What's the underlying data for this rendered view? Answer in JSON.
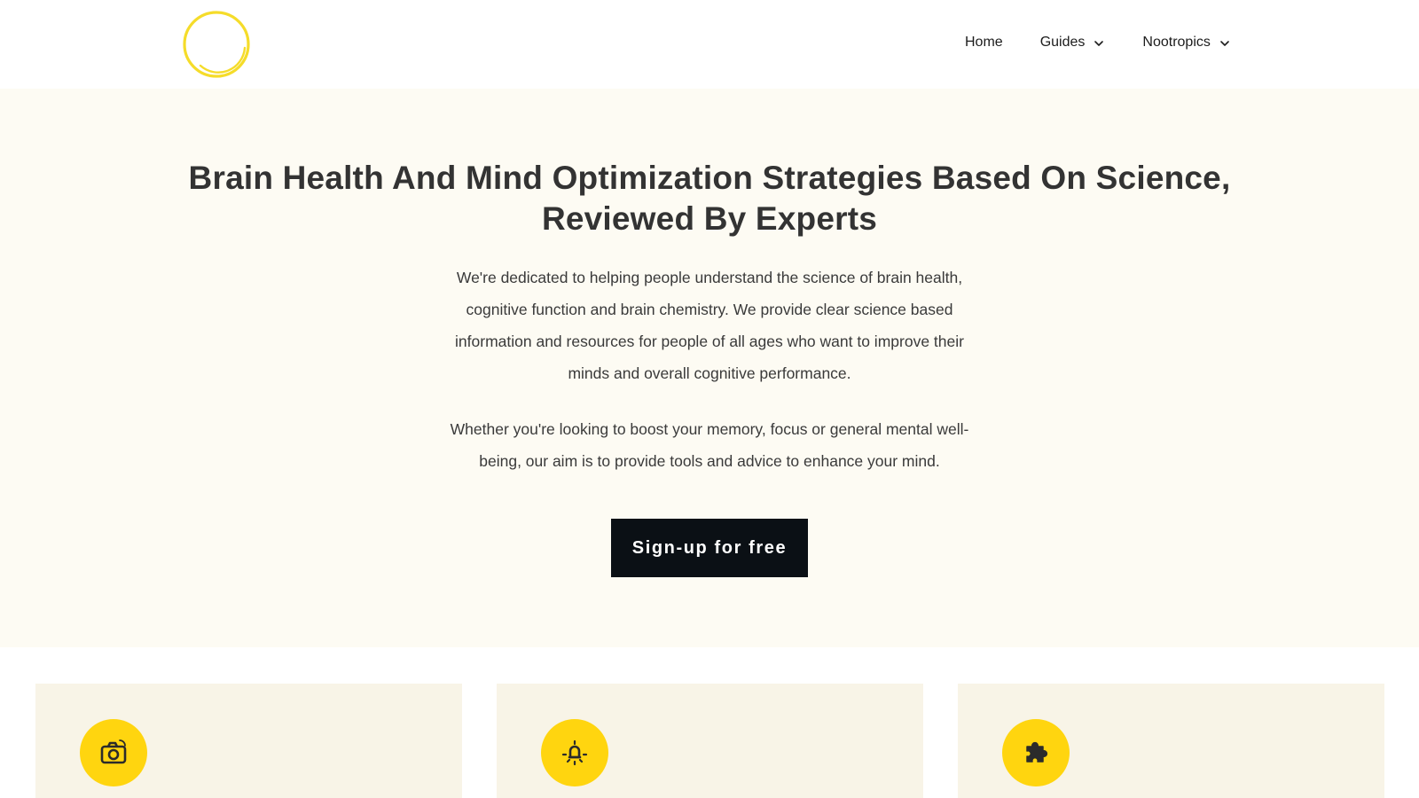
{
  "header": {
    "logo_icon": "yellow-ring-logo",
    "nav": [
      {
        "label": "Home",
        "has_dropdown": false
      },
      {
        "label": "Guides",
        "has_dropdown": true
      },
      {
        "label": "Nootropics",
        "has_dropdown": true
      }
    ]
  },
  "hero": {
    "title": "Brain Health And Mind Optimization Strategies Based On Science, Reviewed By Experts",
    "paragraph_1": "We're dedicated to helping people understand the science of brain health, cognitive function and brain chemistry. We provide clear science based information and resources for people of all ages who want to improve their minds and overall cognitive performance.",
    "paragraph_2": "Whether you're looking to boost your memory, focus or general mental well-being, our aim is to provide tools and advice to enhance your mind.",
    "cta_label": "Sign-up for free"
  },
  "cards": [
    {
      "icon": "camera-icon"
    },
    {
      "icon": "lightbulb-icon"
    },
    {
      "icon": "puzzle-icon"
    }
  ],
  "colors": {
    "accent": "#ffd50f",
    "logo_ring": "#f5dc2a",
    "hero_bg": "#fdfbf3",
    "card_bg": "#f8f4e7",
    "button_bg": "#0b1015",
    "heading": "#333333"
  }
}
